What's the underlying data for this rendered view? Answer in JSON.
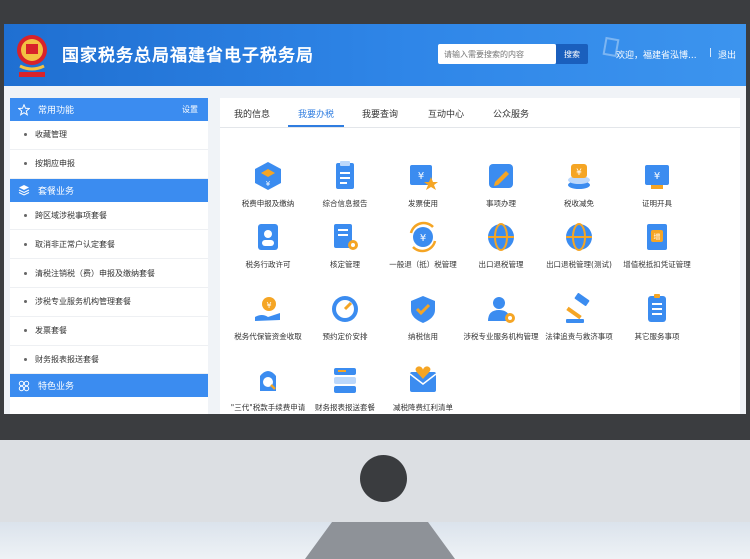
{
  "header": {
    "title": "国家税务总局福建省电子税务局",
    "search_placeholder": "请输入需要搜索的内容",
    "search_button": "搜索",
    "welcome": "欢迎，福建省泓博...",
    "separator": "|",
    "logout": "退出"
  },
  "sidebar": {
    "sections": [
      {
        "title": "常用功能",
        "action": "设置",
        "icon": "star-icon",
        "items": [
          "收藏管理",
          "按期应申报"
        ]
      },
      {
        "title": "套餐业务",
        "icon": "layers-icon",
        "items": [
          "跨区域涉税事项套餐",
          "取消非正常户认定套餐",
          "清税注销税（费）申报及缴纳套餐",
          "涉税专业服务机构管理套餐",
          "发票套餐",
          "财务报表报送套餐"
        ]
      },
      {
        "title": "特色业务",
        "icon": "grid-icon",
        "items": []
      }
    ]
  },
  "tabs": [
    "我的信息",
    "我要办税",
    "我要查询",
    "互动中心",
    "公众服务"
  ],
  "active_tab": "我要办税",
  "services": [
    {
      "label": "税费申报及缴纳",
      "icon": "tax-declare-icon"
    },
    {
      "label": "综合信息报告",
      "icon": "report-icon"
    },
    {
      "label": "发票使用",
      "icon": "invoice-icon"
    },
    {
      "label": "事项办理",
      "icon": "edit-icon"
    },
    {
      "label": "税收减免",
      "icon": "coins-icon"
    },
    {
      "label": "证明开具",
      "icon": "certificate-icon"
    },
    {
      "label": "税务行政许可",
      "icon": "permit-icon"
    },
    {
      "label": "核定管理",
      "icon": "doc-gear-icon"
    },
    {
      "label": "一般退（抵）税管理",
      "icon": "refund-icon"
    },
    {
      "label": "出口退税管理",
      "icon": "globe-icon"
    },
    {
      "label": "出口退税管理(测试)",
      "icon": "globe-test-icon"
    },
    {
      "label": "增值税抵扣凭证管理",
      "icon": "vat-icon"
    },
    {
      "label": "税务代保管资金收取",
      "icon": "money-hand-icon"
    },
    {
      "label": "预约定价安排",
      "icon": "compass-icon"
    },
    {
      "label": "纳税信用",
      "icon": "credit-icon"
    },
    {
      "label": "涉税专业服务机构管理",
      "icon": "agency-icon"
    },
    {
      "label": "法律追责与救济事项",
      "icon": "gavel-icon"
    },
    {
      "label": "其它服务事项",
      "icon": "list-icon"
    },
    {
      "label": "\"三代\"税款手续费申请",
      "icon": "money-search-icon"
    },
    {
      "label": "财务报表报送套餐",
      "icon": "stack-icon"
    },
    {
      "label": "减税降费红利清单",
      "icon": "envelope-heart-icon"
    }
  ],
  "colors": {
    "header": "#2f86e8",
    "accent": "#3b8cf0",
    "active_tab": "#2f7de0",
    "icon_orange": "#f5a524"
  }
}
